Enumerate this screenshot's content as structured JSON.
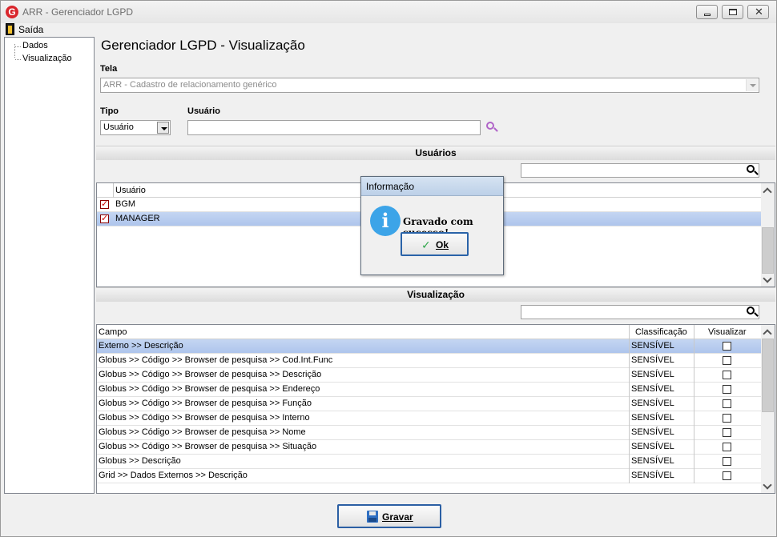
{
  "window": {
    "title": "ARR - Gerenciador LGPD",
    "app_icon_letter": "G"
  },
  "menu": {
    "exit_label": "Saída"
  },
  "tree": {
    "items": [
      {
        "label": "Dados"
      },
      {
        "label": "Visualização"
      }
    ]
  },
  "page": {
    "title": "Gerenciador LGPD - Visualização"
  },
  "form": {
    "tela_label": "Tela",
    "tela_value": "ARR - Cadastro de relacionamento genérico",
    "tipo_label": "Tipo",
    "tipo_value": "Usuário",
    "usuario_label": "Usuário",
    "usuario_value": ""
  },
  "users_section": {
    "title": "Usuários",
    "filter_value": "",
    "column_header": "Usuário",
    "rows": [
      {
        "name": "BGM",
        "checked": true,
        "selected": false
      },
      {
        "name": "MANAGER",
        "checked": true,
        "selected": true
      }
    ]
  },
  "view_section": {
    "title": "Visualização",
    "filter_value": "",
    "columns": {
      "field": "Campo",
      "classification": "Classificação",
      "visualize": "Visualizar"
    },
    "rows": [
      {
        "field": "Externo >> Descrição",
        "classification": "SENSÍVEL",
        "visualize": false,
        "selected": true
      },
      {
        "field": "Globus >> Código >> Browser de pesquisa >> Cod.Int.Func",
        "classification": "SENSÍVEL",
        "visualize": false
      },
      {
        "field": "Globus >> Código >> Browser de pesquisa >> Descrição",
        "classification": "SENSÍVEL",
        "visualize": false
      },
      {
        "field": "Globus >> Código >> Browser de pesquisa >> Endereço",
        "classification": "SENSÍVEL",
        "visualize": false
      },
      {
        "field": "Globus >> Código >> Browser de pesquisa >> Função",
        "classification": "SENSÍVEL",
        "visualize": false
      },
      {
        "field": "Globus >> Código >> Browser de pesquisa >> Interno",
        "classification": "SENSÍVEL",
        "visualize": false
      },
      {
        "field": "Globus >> Código >> Browser de pesquisa >> Nome",
        "classification": "SENSÍVEL",
        "visualize": false
      },
      {
        "field": "Globus >> Código >> Browser de pesquisa >> Situação",
        "classification": "SENSÍVEL",
        "visualize": false
      },
      {
        "field": "Globus >> Descrição",
        "classification": "SENSÍVEL",
        "visualize": false
      },
      {
        "field": "Grid >> Dados Externos >>  Descrição",
        "classification": "SENSÍVEL",
        "visualize": false
      }
    ]
  },
  "dialog": {
    "title": "Informação",
    "icon": "info-icon",
    "message": "Gravado com sucesso!",
    "ok_label": "Ok"
  },
  "footer": {
    "save_label": "Gravar"
  },
  "colors": {
    "selection": "#aec5ec",
    "check_red": "#d00000",
    "button_border": "#2b5fa4"
  }
}
